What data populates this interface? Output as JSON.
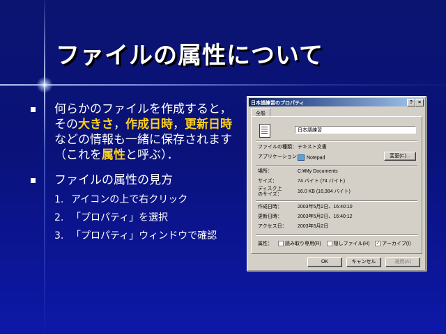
{
  "slide": {
    "title": "ファイルの属性について",
    "bullet1": {
      "p1": "何らかのファイルを作成すると，その",
      "h1": "大きさ",
      "p2": "，",
      "h2": "作成日時",
      "p3": "，",
      "h3": "更新日時",
      "p4": "などの情報も一緒に保存されます（これを",
      "h4": "属性",
      "p5": "と呼ぶ）．"
    },
    "bullet2": "ファイルの属性の見方",
    "steps": [
      {
        "num": "1.",
        "text": "アイコンの上で右クリック"
      },
      {
        "num": "2.",
        "text": "「プロパティ」を選択"
      },
      {
        "num": "3.",
        "text": "「プロパティ」ウィンドウで確認"
      }
    ],
    "highlight_color": "#ffd21a"
  },
  "dialog": {
    "title": "日本語練習のプロパティ",
    "help_button": "?",
    "close_button": "×",
    "tab": "全般",
    "filename": "日本語練習",
    "rows": {
      "type_label": "ファイルの種類：",
      "type_value": "テキスト文書",
      "app_label": "アプリケーション：",
      "app_value": "Notepad",
      "change_button": "変更(C)...",
      "location_label": "場所：",
      "location_value": "C:¥My Documents",
      "size_label": "サイズ：",
      "size_value": "74 バイト (74 バイト)",
      "disk_label1": "ディスク上",
      "disk_label2": "のサイズ：",
      "disk_value": "16.0 KB (16,384 バイト)",
      "created_label": "作成日時：",
      "created_value": "2003年5月2日、16:40:10",
      "modified_label": "更新日時：",
      "modified_value": "2003年5月2日、16:40:12",
      "accessed_label": "アクセス日：",
      "accessed_value": "2003年5月2日"
    },
    "attributes": {
      "label": "属性：",
      "readonly": "読み取り専用(R)",
      "readonly_checked": false,
      "hidden": "隠しファイル(H)",
      "hidden_checked": false,
      "archive": "アーカイブ(I)",
      "archive_checked": true,
      "check_mark": "✓"
    },
    "buttons": {
      "ok": "OK",
      "cancel": "キャンセル",
      "apply": "適用(A)"
    }
  }
}
